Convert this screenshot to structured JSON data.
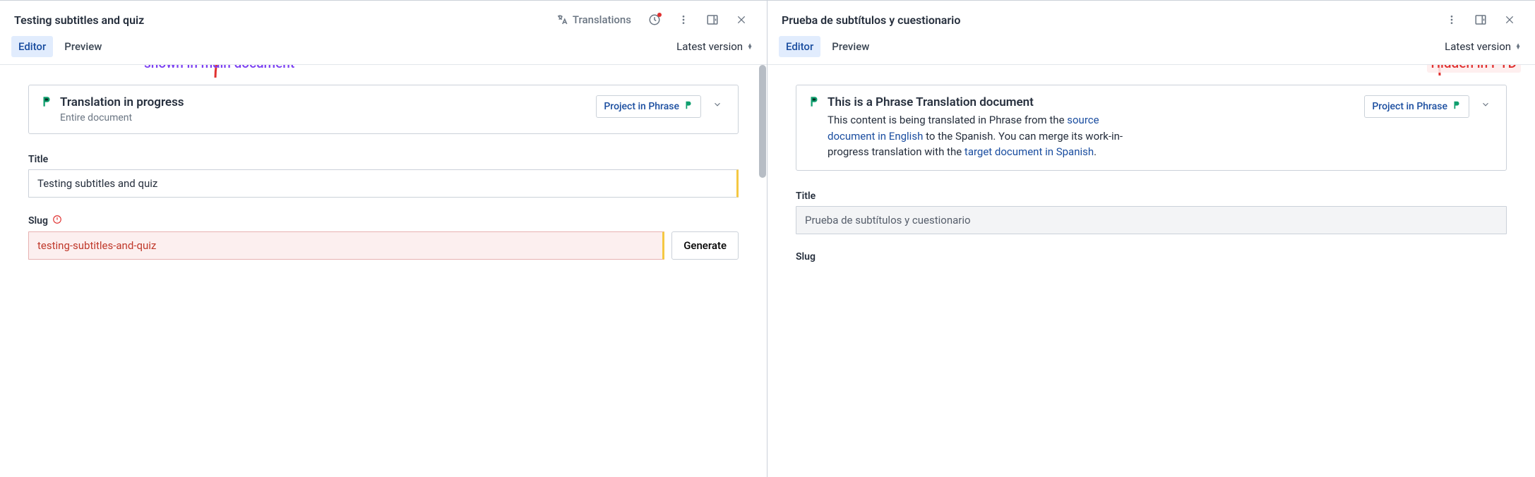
{
  "left": {
    "title": "Testing subtitles and quiz",
    "header": {
      "translations_label": "Translations"
    },
    "tabs": {
      "editor": "Editor",
      "preview": "Preview"
    },
    "version_label": "Latest version",
    "annotation": "shown in main document",
    "card": {
      "title": "Translation in progress",
      "subtitle": "Entire document",
      "chip": "Project in Phrase"
    },
    "fields": {
      "title_label": "Title",
      "title_value": "Testing subtitles and quiz",
      "slug_label": "Slug",
      "slug_value": "testing-subtitles-and-quiz",
      "generate_label": "Generate"
    }
  },
  "right": {
    "title": "Prueba de subtítulos y cuestionario",
    "tabs": {
      "editor": "Editor",
      "preview": "Preview"
    },
    "version_label": "Latest version",
    "annotation": "Hidden in PTD",
    "card": {
      "title": "This is a Phrase Translation document",
      "desc_1": "This content is being translated in Phrase from the ",
      "link_1": "source document in English",
      "desc_2": " to the Spanish. You can merge its work-in-progress translation with the ",
      "link_2": "target document in Spanish",
      "desc_3": ".",
      "chip": "Project in Phrase"
    },
    "fields": {
      "title_label": "Title",
      "title_value": "Prueba de subtítulos y cuestionario",
      "slug_label": "Slug"
    }
  }
}
